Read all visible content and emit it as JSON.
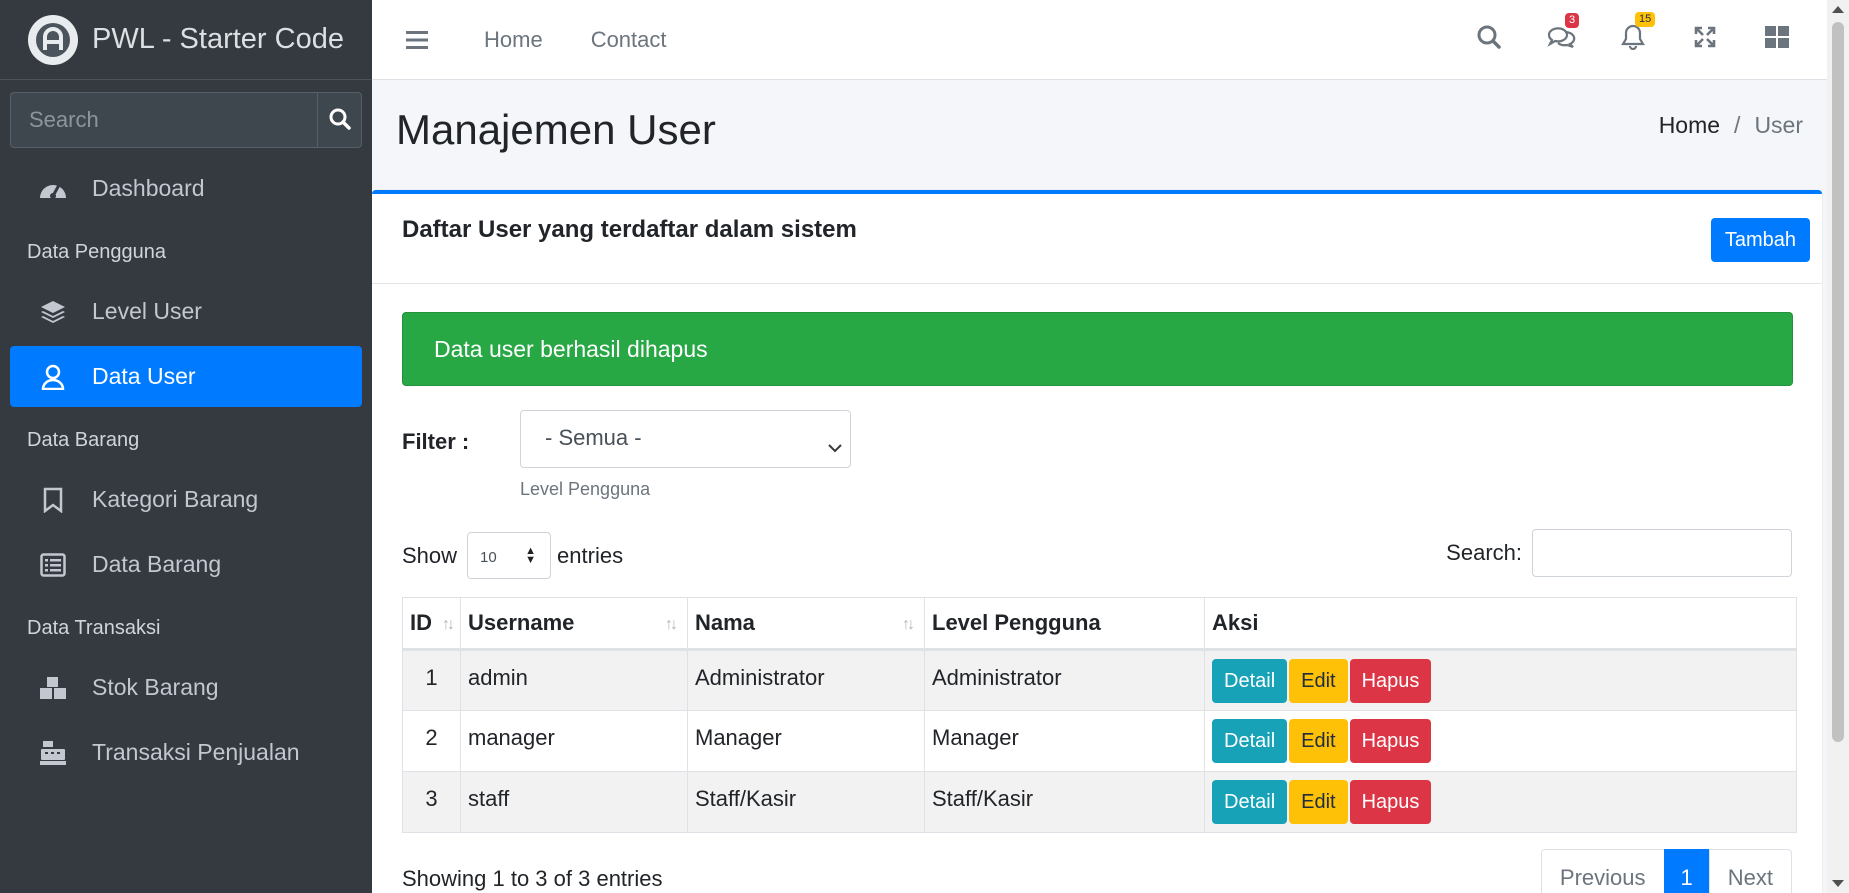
{
  "sidebar": {
    "brand": "PWL - Starter Code",
    "search_placeholder": "Search",
    "items": [
      {
        "label": "Dashboard"
      },
      {
        "header": "Data Pengguna"
      },
      {
        "label": "Level User"
      },
      {
        "label": "Data User",
        "active": true
      },
      {
        "header": "Data Barang"
      },
      {
        "label": "Kategori Barang"
      },
      {
        "label": "Data Barang"
      },
      {
        "header": "Data Transaksi"
      },
      {
        "label": "Stok Barang"
      },
      {
        "label": "Transaksi Penjualan"
      }
    ]
  },
  "topbar": {
    "links": [
      "Home",
      "Contact"
    ],
    "messages_badge": "3",
    "notifications_badge": "15"
  },
  "header": {
    "title": "Manajemen User",
    "breadcrumb": [
      "Home",
      "User"
    ]
  },
  "card": {
    "title": "Daftar User yang terdaftar dalam sistem",
    "add_button": "Tambah",
    "alert": "Data user berhasil dihapus",
    "filter": {
      "label": "Filter :",
      "selected": "- Semua -",
      "hint": "Level Pengguna"
    },
    "length": {
      "show": "Show",
      "value": "10",
      "entries": "entries"
    },
    "search_label": "Search:",
    "columns": [
      "ID",
      "Username",
      "Nama",
      "Level Pengguna",
      "Aksi"
    ],
    "rows": [
      {
        "id": "1",
        "username": "admin",
        "nama": "Administrator",
        "level": "Administrator"
      },
      {
        "id": "2",
        "username": "manager",
        "nama": "Manager",
        "level": "Manager"
      },
      {
        "id": "3",
        "username": "staff",
        "nama": "Staff/Kasir",
        "level": "Staff/Kasir"
      }
    ],
    "actions": {
      "detail": "Detail",
      "edit": "Edit",
      "hapus": "Hapus"
    },
    "info": "Showing 1 to 3 of 3 entries",
    "pagination": {
      "previous": "Previous",
      "current": "1",
      "next": "Next"
    }
  },
  "colors": {
    "primary": "#007bff",
    "success": "#28a745",
    "info": "#17a2b8",
    "warning": "#ffc107",
    "danger": "#dc3545",
    "sidebar_bg": "#343a40"
  },
  "icons": [
    "brand-logo-icon",
    "search-icon",
    "dashboard-icon",
    "layers-icon",
    "user-icon",
    "bookmark-icon",
    "list-icon",
    "cubes-icon",
    "cash-register-icon",
    "hamburger-icon",
    "comments-icon",
    "bell-icon",
    "expand-icon",
    "grid-icon"
  ]
}
